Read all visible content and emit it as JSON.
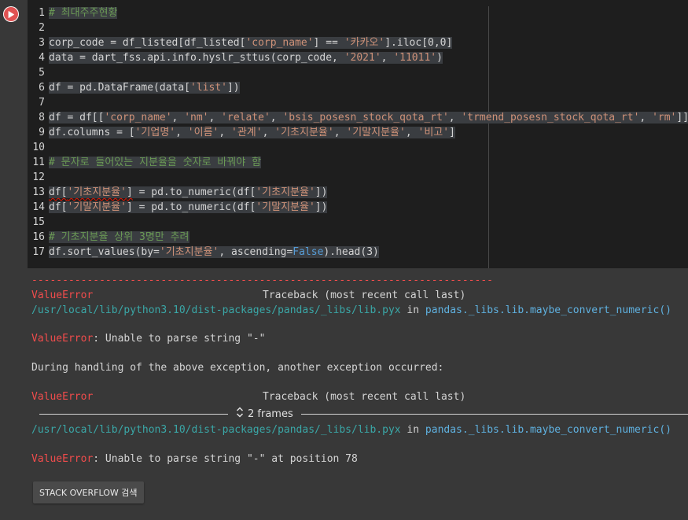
{
  "code_lines": [
    {
      "n": "1",
      "parts": [
        {
          "t": "# 최대주주현황",
          "c": "cm"
        }
      ]
    },
    {
      "n": "2",
      "parts": []
    },
    {
      "n": "3",
      "parts": [
        {
          "t": "corp_code = df_listed[df_listed[",
          "c": ""
        },
        {
          "t": "'corp_name'",
          "c": "st"
        },
        {
          "t": "] == ",
          "c": ""
        },
        {
          "t": "'카카오'",
          "c": "st"
        },
        {
          "t": "].iloc[0,0]",
          "c": ""
        }
      ]
    },
    {
      "n": "4",
      "parts": [
        {
          "t": "data = dart_fss.api.info.hyslr_sttus(corp_code, ",
          "c": ""
        },
        {
          "t": "'2021'",
          "c": "st"
        },
        {
          "t": ", ",
          "c": ""
        },
        {
          "t": "'11011'",
          "c": "st"
        },
        {
          "t": ")",
          "c": ""
        }
      ]
    },
    {
      "n": "5",
      "parts": []
    },
    {
      "n": "6",
      "parts": [
        {
          "t": "df = pd.DataFrame(data[",
          "c": ""
        },
        {
          "t": "'list'",
          "c": "st"
        },
        {
          "t": "])",
          "c": ""
        }
      ]
    },
    {
      "n": "7",
      "parts": []
    },
    {
      "n": "8",
      "parts": [
        {
          "t": "df = df[[",
          "c": ""
        },
        {
          "t": "'corp_name'",
          "c": "st"
        },
        {
          "t": ", ",
          "c": ""
        },
        {
          "t": "'nm'",
          "c": "st"
        },
        {
          "t": ", ",
          "c": ""
        },
        {
          "t": "'relate'",
          "c": "st"
        },
        {
          "t": ", ",
          "c": ""
        },
        {
          "t": "'bsis_posesn_stock_qota_rt'",
          "c": "st"
        },
        {
          "t": ", ",
          "c": ""
        },
        {
          "t": "'trmend_posesn_stock_qota_rt'",
          "c": "st"
        },
        {
          "t": ", ",
          "c": ""
        },
        {
          "t": "'rm'",
          "c": "st"
        },
        {
          "t": "]]",
          "c": ""
        }
      ]
    },
    {
      "n": "9",
      "parts": [
        {
          "t": "df.columns = [",
          "c": ""
        },
        {
          "t": "'기업명'",
          "c": "st"
        },
        {
          "t": ", ",
          "c": ""
        },
        {
          "t": "'이름'",
          "c": "st"
        },
        {
          "t": ", ",
          "c": ""
        },
        {
          "t": "'관계'",
          "c": "st"
        },
        {
          "t": ", ",
          "c": ""
        },
        {
          "t": "'기초지분율'",
          "c": "st"
        },
        {
          "t": ", ",
          "c": ""
        },
        {
          "t": "'기말지분율'",
          "c": "st"
        },
        {
          "t": ", ",
          "c": ""
        },
        {
          "t": "'비고'",
          "c": "st"
        },
        {
          "t": "]",
          "c": ""
        }
      ]
    },
    {
      "n": "10",
      "parts": []
    },
    {
      "n": "11",
      "parts": [
        {
          "t": "# 문자로 들어있는 지분율을 숫자로 바꿔야 함",
          "c": "cm"
        }
      ]
    },
    {
      "n": "12",
      "parts": []
    },
    {
      "n": "13",
      "parts": [
        {
          "t": "df[",
          "c": "squig"
        },
        {
          "t": "'기초지분율'",
          "c": "st squig"
        },
        {
          "t": "]",
          "c": "squig"
        },
        {
          "t": " = pd.to_numeric(df[",
          "c": ""
        },
        {
          "t": "'기초지분율'",
          "c": "st"
        },
        {
          "t": "])",
          "c": ""
        }
      ]
    },
    {
      "n": "14",
      "parts": [
        {
          "t": "df[",
          "c": ""
        },
        {
          "t": "'기말지분율'",
          "c": "st"
        },
        {
          "t": "] = pd.to_numeric(df[",
          "c": ""
        },
        {
          "t": "'기말지분율'",
          "c": "st"
        },
        {
          "t": "])",
          "c": ""
        }
      ]
    },
    {
      "n": "15",
      "parts": []
    },
    {
      "n": "16",
      "parts": [
        {
          "t": "# 기초지분율 상위 3명만 추려",
          "c": "cm"
        }
      ]
    },
    {
      "n": "17",
      "parts": [
        {
          "t": "df.sort_values(by=",
          "c": ""
        },
        {
          "t": "'기초지분율'",
          "c": "st"
        },
        {
          "t": ", ascending=",
          "c": ""
        },
        {
          "t": "False",
          "c": "kw"
        },
        {
          "t": ").head(3)",
          "c": ""
        }
      ]
    }
  ],
  "output": {
    "separator": "---------------------------------------------------------------------------",
    "tb1_error": "ValueError",
    "tb1_header": "Traceback (most recent call last)",
    "tb1_path": "/usr/local/lib/python3.10/dist-packages/pandas/_libs/lib.pyx",
    "tb1_in": " in ",
    "tb1_func": "pandas._libs.lib.maybe_convert_numeric()",
    "err1_name": "ValueError",
    "err1_msg": ": Unable to parse string \"-\"",
    "during": "During handling of the above exception, another exception occurred:",
    "tb2_error": "ValueError",
    "tb2_header": "Traceback (most recent call last)",
    "frames_label": "2 frames",
    "tb2_path": "/usr/local/lib/python3.10/dist-packages/pandas/_libs/lib.pyx",
    "tb2_in": " in ",
    "tb2_func": "pandas._libs.lib.maybe_convert_numeric()",
    "err2_name": "ValueError",
    "err2_msg": ": Unable to parse string \"-\" at position 78",
    "so_button": "STACK OVERFLOW 검색"
  },
  "icons": {
    "run": "run-play-icon",
    "frames": "expand-frames-icon"
  },
  "colors": {
    "error": "#f14c4c",
    "path": "#3aa7a7",
    "string": "#ce9178",
    "comment": "#6a9955",
    "keyword": "#569cd6"
  }
}
